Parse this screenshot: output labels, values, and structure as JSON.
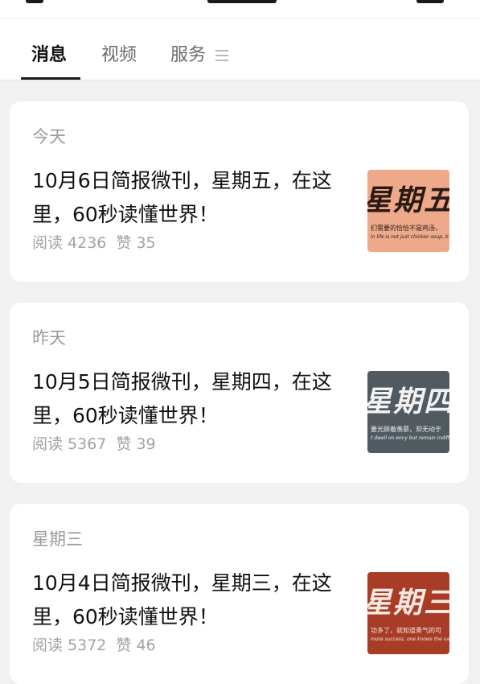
{
  "tabs": [
    {
      "label": "消息",
      "active": true
    },
    {
      "label": "视频",
      "active": false
    },
    {
      "label": "服务",
      "active": false
    }
  ],
  "menu_icon": "menu-icon",
  "articles": [
    {
      "date": "今天",
      "title": "10月6日简报微刊，星期五，在这里，60秒读懂世界！",
      "reads": "阅读 4236",
      "likes": "赞 35",
      "thumb": {
        "big": "星期五",
        "caption": "们需要的恰恰不是鸡汤，",
        "caption_en": "in life is not just chicken soup, b",
        "bg": "#eea98a",
        "fg": "#2a1a14"
      }
    },
    {
      "date": "昨天",
      "title": "10月5日简报微刊，星期四，在这里，60秒读懂世界！",
      "reads": "阅读 5367",
      "likes": "赞 39",
      "thumb": {
        "big": "星期四",
        "caption": "要光顾着羡慕，却无动于",
        "caption_en": "t dwell on envy but remain indiffere",
        "bg": "#505a60",
        "fg": "#f2f2f2"
      }
    },
    {
      "date": "星期三",
      "title": "10月4日简报微刊，星期三，在这里，60秒读懂世界！",
      "reads": "阅读 5372",
      "likes": "赞 46",
      "thumb": {
        "big": "星期三",
        "caption": "功多了，就知道勇气的可",
        "caption_en": "more success, one knows the value of coura",
        "bg": "#a83c26",
        "fg": "#f7e9e2"
      }
    }
  ]
}
